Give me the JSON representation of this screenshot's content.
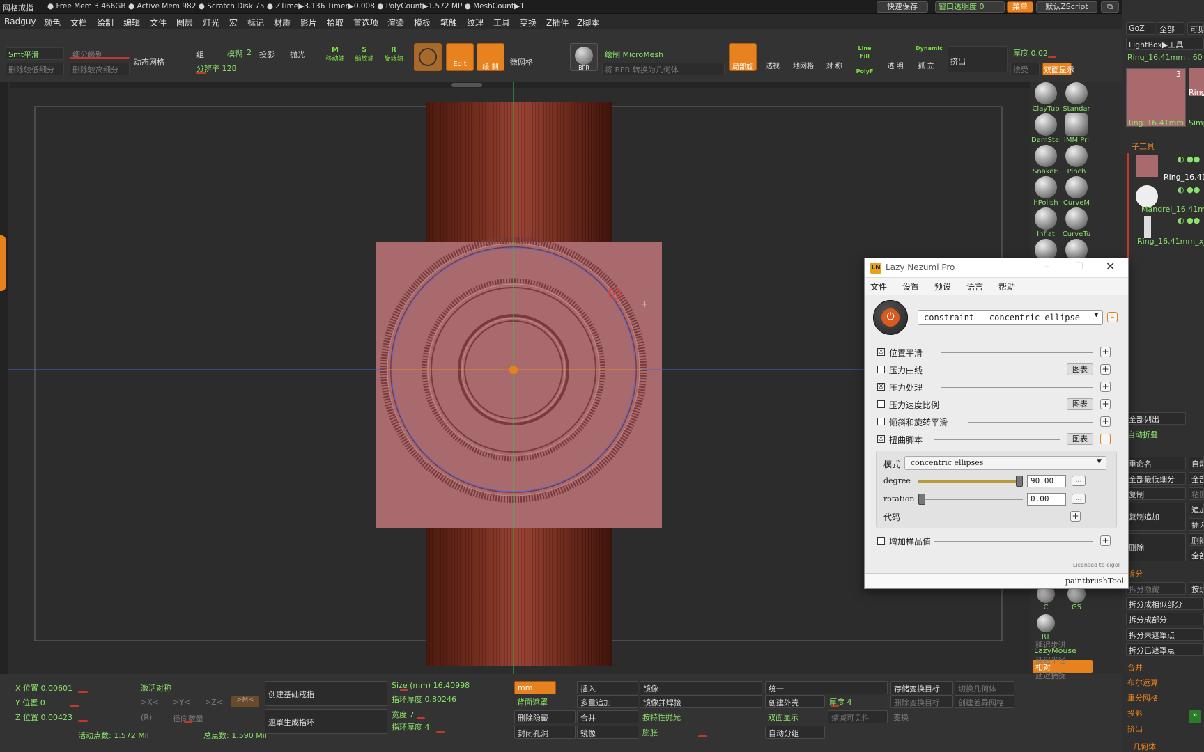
{
  "titlebar": {
    "app_title": "网格戒指",
    "stats": "● Free Mem 3.466GB ● Active Mem 982 ● Scratch Disk 75 ● ZTime▶3.136 Timer▶0.008 ● PolyCount▶1.572 MP ● MeshCount▶1",
    "quicksave": "快速保存",
    "window_opacity": "窗口透明度 0",
    "menu": "菜单",
    "default_zscript": "默认ZScript"
  },
  "menubar": [
    "Badguy",
    "颜色",
    "文档",
    "绘制",
    "编辑",
    "文件",
    "图层",
    "灯光",
    "宏",
    "标记",
    "材质",
    "影片",
    "拾取",
    "首选项",
    "渲染",
    "模板",
    "笔触",
    "纹理",
    "工具",
    "变换",
    "Z插件",
    "Z脚本"
  ],
  "topshelf": {
    "smt_smooth": "Smt平滑",
    "subdiv_level": "细分级别",
    "del_lower": "删除较低细分",
    "del_higher": "删除较高细分",
    "dynamesh": "动态网格",
    "group": "组",
    "blur": "模糊",
    "blur_val": "2",
    "project": "投影",
    "polish": "抛光",
    "resolution": "分辨率 128",
    "move": "移动轴",
    "scale": "缩放轴",
    "rotate": "旋转轴",
    "edit": "Edit",
    "draw": "绘 制",
    "micromesh": "微网格",
    "bpr": "BPR",
    "draw_micromesh": "绘制 MicroMesh",
    "bpr_to_geo": "将 BPR 转换为几何体",
    "tool_reset": "局部旋",
    "transparent": "透视",
    "floor": "地网格",
    "symmetry": "对 称",
    "linefill": "Line Fill",
    "polyf": "PolyF",
    "transp": "透 明",
    "solo": "孤 立",
    "dynamic": "Dynamic",
    "extrude": "挤出",
    "thickness": "厚度 0.02",
    "accept": "接受",
    "double_sided": "双面显示"
  },
  "viewport": {
    "cursor": "+"
  },
  "brushes": [
    {
      "label": "ClayTub"
    },
    {
      "label": "Standar"
    },
    {
      "label": "DamStai"
    },
    {
      "label": "IMM Pri"
    },
    {
      "label": "SnakeH"
    },
    {
      "label": "Pinch"
    },
    {
      "label": "hPolish"
    },
    {
      "label": "CurveM"
    },
    {
      "label": "Inflat"
    },
    {
      "label": "CurveTu"
    }
  ],
  "brushes_lower": [
    {
      "label": "C"
    },
    {
      "label": "GS"
    },
    {
      "label": "RT"
    }
  ],
  "lazymouse": {
    "title": "LazyMouse",
    "relative": "相对",
    "step": "延迟步进",
    "radius": "延迟半径",
    "snap": "延迟捕捉"
  },
  "rightpanel": {
    "goz": "GoZ",
    "all": "全部",
    "visible": "可见",
    "lightbox_tool": "LightBox▶工具",
    "tool_name": "Ring_16.41mm . 60",
    "thumb_count": "3",
    "thumb_name": "Ring_16.41mm",
    "thumb_name2": "Ring",
    "thumb_simple": "Simp",
    "subtool": "子工具",
    "subtools": [
      "Ring_16.41",
      "Mandrel_16.41mm",
      "Ring_16.41mm_x_0"
    ],
    "list_all": "全部列出",
    "auto_collapse": "自动折叠",
    "rename": "重命名",
    "all_lowest": "全部最低细分",
    "copy": "复制",
    "copy_append": "复制追加",
    "delete": "删除",
    "split": "拆分",
    "split_hidden": "拆分隐藏",
    "split_similar": "拆分成相似部分",
    "split_parts": "拆分成部分",
    "split_unmasked": "拆分未遮罩点",
    "split_masked": "拆分已遮罩点",
    "merge": "合并",
    "boolean": "布尔运算",
    "remesh": "重分网格",
    "project": "投影",
    "extract": "挤出",
    "geometry": "几何体",
    "r_auto": "自动",
    "r_all": "全部",
    "r_paste": "粘贴",
    "r_append": "追加",
    "r_insert": "插入",
    "r_del": "删除",
    "r_all2": "全部",
    "r_axis": "按组"
  },
  "bottom": {
    "x_pos": "X 位置 0.00601",
    "y_pos": "Y 位置 0",
    "z_pos": "Z 位置 0.00423",
    "activate_sym": "激活对称",
    "sym_x": ">X<",
    "sym_y": ">Y<",
    "sym_z": ">Z<",
    "sym_m": ">M<",
    "sym_r": "(R)",
    "radial": "径向数量",
    "active_points": "活动点数: 1.572 Mil",
    "total_points": "总点数: 1.590 Mil",
    "create_ring": "创建基础戒指",
    "mask_ring": "遮罩生成指环",
    "size_mm": "Size (mm) 16.40998",
    "ring_thick": "指环厚度 0.80246",
    "width": "宽度 7",
    "ring_thick2": "指环厚度 4",
    "unit": "mm",
    "back_mask": "背面遮罩",
    "del_hidden": "删除隐藏",
    "close_holes": "封闭孔洞",
    "insert": "插入",
    "multi_append": "多重追加",
    "merge": "合并",
    "mirror": "镜像",
    "mirror2": "镜像",
    "mirror_weld": "镜像并焊接",
    "polish_feat": "按特性抛光",
    "inflate": "膨胀",
    "unify": "统一",
    "create_shell": "创建外壳",
    "double": "双面显示",
    "auto_group": "自动分组",
    "thickness": "厚度 4",
    "store_morph": "存储变换目标",
    "del_morph": "删除变换目标",
    "switch_geo": "切换几何体",
    "create_diff": "创建差异网格",
    "reduce_vis": "缩减可见性",
    "morph": "变换"
  },
  "lazy_nezumi": {
    "title": "Lazy Nezumi Pro",
    "menu": [
      "文件",
      "设置",
      "预设",
      "语言",
      "帮助"
    ],
    "preset": "constraint - concentric ellipse",
    "rows": [
      {
        "label": "位置平滑",
        "checked": "☒"
      },
      {
        "label": "压力曲线",
        "checked": "",
        "chart": "图表"
      },
      {
        "label": "压力处理",
        "checked": "☒"
      },
      {
        "label": "压力速度比例",
        "checked": "",
        "chart": "图表"
      },
      {
        "label": "倾斜和旋转平滑",
        "checked": ""
      },
      {
        "label": "扭曲脚本",
        "checked": "☒",
        "chart": "图表"
      }
    ],
    "mode_label": "模式",
    "mode_value": "concentric ellipses",
    "degree_label": "degree",
    "degree_value": "90.00",
    "degree_fraction": 1.0,
    "rotation_label": "rotation",
    "rotation_value": "0.00",
    "rotation_fraction": 0.0,
    "code_label": "代码",
    "add_samples": "增加样品值",
    "licensed": "Licensed to cigol",
    "status": "paintbrushTool",
    "more": "..."
  }
}
